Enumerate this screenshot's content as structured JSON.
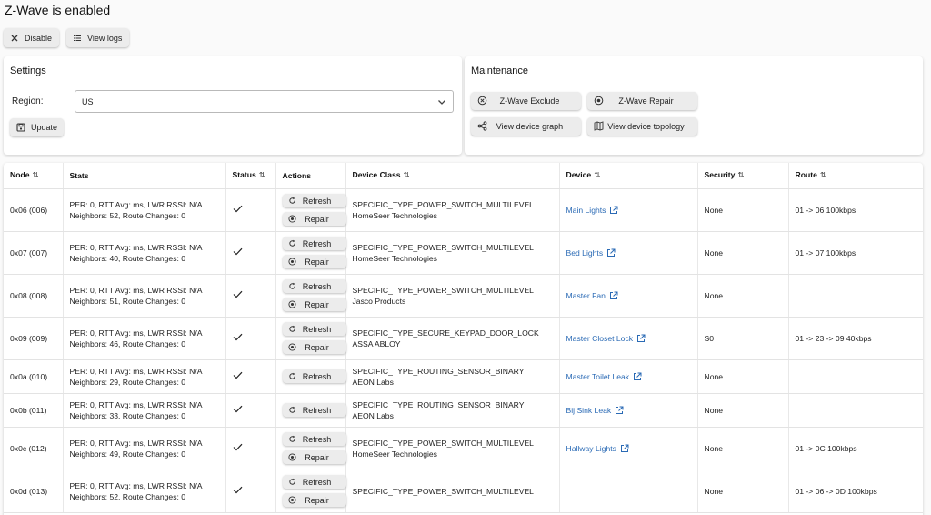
{
  "page": {
    "title": "Z-Wave is enabled"
  },
  "toolbar": {
    "disable_label": "Disable",
    "view_logs_label": "View logs"
  },
  "settings": {
    "title": "Settings",
    "region_label": "Region:",
    "region_value": "US",
    "update_label": "Update"
  },
  "maintenance": {
    "title": "Maintenance",
    "exclude_label": "Z-Wave Exclude",
    "repair_label": "Z-Wave Repair",
    "graph_label": "View device graph",
    "topology_label": "View device topology"
  },
  "table": {
    "headers": {
      "node": "Node",
      "stats": "Stats",
      "status": "Status",
      "actions": "Actions",
      "device_class": "Device Class",
      "device": "Device",
      "security": "Security",
      "route": "Route"
    },
    "refresh_label": "Refresh",
    "repair_label": "Repair",
    "rows": [
      {
        "node": "0x06 (006)",
        "stats1": "PER: 0, RTT Avg: ms, LWR RSSI: N/A",
        "stats2": "Neighbors: 52, Route Changes: 0",
        "class1": "SPECIFIC_TYPE_POWER_SWITCH_MULTILEVEL",
        "class2": "HomeSeer Technologies",
        "device": "Main Lights",
        "security": "None",
        "route": "01 -> 06 100kbps",
        "repair": true
      },
      {
        "node": "0x07 (007)",
        "stats1": "PER: 0, RTT Avg: ms, LWR RSSI: N/A",
        "stats2": "Neighbors: 40, Route Changes: 0",
        "class1": "SPECIFIC_TYPE_POWER_SWITCH_MULTILEVEL",
        "class2": "HomeSeer Technologies",
        "device": "Bed Lights",
        "security": "None",
        "route": "01 -> 07 100kbps",
        "repair": true
      },
      {
        "node": "0x08 (008)",
        "stats1": "PER: 0, RTT Avg: ms, LWR RSSI: N/A",
        "stats2": "Neighbors: 51, Route Changes: 0",
        "class1": "SPECIFIC_TYPE_POWER_SWITCH_MULTILEVEL",
        "class2": "Jasco Products",
        "device": "Master Fan",
        "security": "None",
        "route": "",
        "repair": true
      },
      {
        "node": "0x09 (009)",
        "stats1": "PER: 0, RTT Avg: ms, LWR RSSI: N/A",
        "stats2": "Neighbors: 46, Route Changes: 0",
        "class1": "SPECIFIC_TYPE_SECURE_KEYPAD_DOOR_LOCK",
        "class2": "ASSA ABLOY",
        "device": "Master Closet Lock",
        "security": "S0",
        "route": "01 -> 23 -> 09 40kbps",
        "repair": true
      },
      {
        "node": "0x0a (010)",
        "stats1": "PER: 0, RTT Avg: ms, LWR RSSI: N/A",
        "stats2": "Neighbors: 29, Route Changes: 0",
        "class1": "SPECIFIC_TYPE_ROUTING_SENSOR_BINARY",
        "class2": "AEON Labs",
        "device": "Master Toilet Leak",
        "security": "None",
        "route": "",
        "repair": false
      },
      {
        "node": "0x0b (011)",
        "stats1": "PER: 0, RTT Avg: ms, LWR RSSI: N/A",
        "stats2": "Neighbors: 33, Route Changes: 0",
        "class1": "SPECIFIC_TYPE_ROUTING_SENSOR_BINARY",
        "class2": "AEON Labs",
        "device": "Bij Sink Leak",
        "security": "None",
        "route": "",
        "repair": false
      },
      {
        "node": "0x0c (012)",
        "stats1": "PER: 0, RTT Avg: ms, LWR RSSI: N/A",
        "stats2": "Neighbors: 49, Route Changes: 0",
        "class1": "SPECIFIC_TYPE_POWER_SWITCH_MULTILEVEL",
        "class2": "HomeSeer Technologies",
        "device": "Hallway Lights",
        "security": "None",
        "route": "01 -> 0C 100kbps",
        "repair": true
      },
      {
        "node": "0x0d (013)",
        "stats1": "PER: 0, RTT Avg: ms, LWR RSSI: N/A",
        "stats2": "Neighbors: 52, Route Changes: 0",
        "class1": "SPECIFIC_TYPE_POWER_SWITCH_MULTILEVEL",
        "class2": "",
        "device": "",
        "security": "None",
        "route": "01 -> 06 -> 0D 100kbps",
        "repair": true
      }
    ]
  }
}
